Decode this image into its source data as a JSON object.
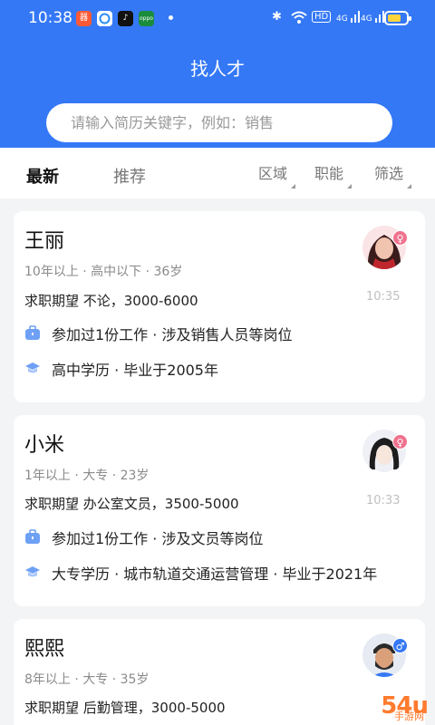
{
  "status_bar": {
    "time": "10:38",
    "app_icons": [
      "finder-app-icon",
      "circle-app-icon",
      "tiktok-icon",
      "oppo-icon"
    ],
    "oppo_label": "oppo",
    "hd_label": "HD",
    "signal_labels": [
      "4G",
      "4G"
    ],
    "battery_level": 0.75,
    "battery_color": "#ffd43b"
  },
  "header": {
    "title": "找人才",
    "search_placeholder": "请输入简历关键字，例如：销售",
    "accent": "#3478f6"
  },
  "tabs": {
    "latest": "最新",
    "recommended": "推荐"
  },
  "filters": {
    "region": "区域",
    "function": "职能",
    "filter": "筛选"
  },
  "cards": [
    {
      "name": "王丽",
      "meta": "10年以上 · 高中以下 · 36岁",
      "expect": "求职期望 不论，3000-6000",
      "time": "10:35",
      "work": "参加过1份工作 · 涉及销售人员等岗位",
      "edu": "高中学历 · 毕业于2005年",
      "gender": "female"
    },
    {
      "name": "小米",
      "meta": "1年以上 · 大专 · 23岁",
      "expect": "求职期望 办公室文员，3500-5000",
      "time": "10:33",
      "work": "参加过1份工作 · 涉及文员等岗位",
      "edu": "大专学历 · 城市轨道交通运营管理 · 毕业于2021年",
      "gender": "female"
    },
    {
      "name": "熙熙",
      "meta": "8年以上 · 大专 · 35岁",
      "expect": "求职期望 后勤管理，3000-5000",
      "gender": "male"
    }
  ],
  "watermark": {
    "main": "54u",
    "sub": "手游网"
  }
}
